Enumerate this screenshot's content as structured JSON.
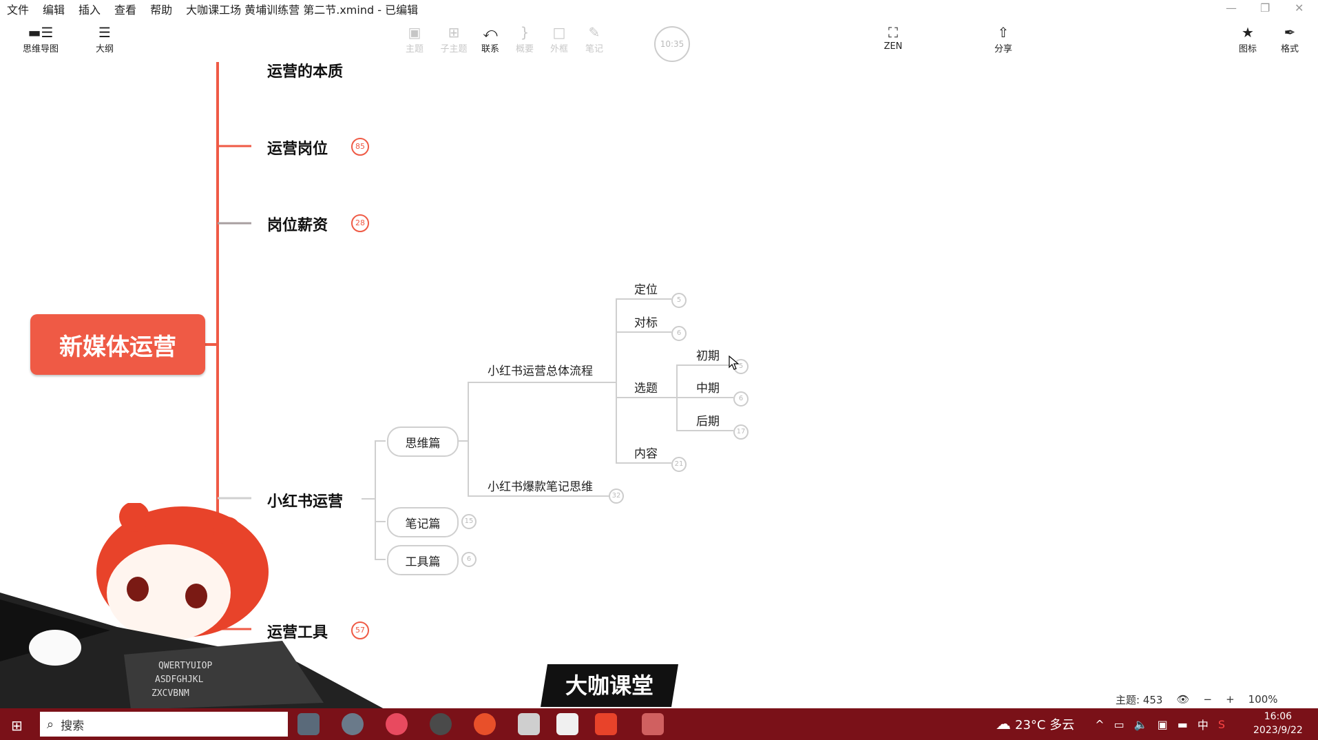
{
  "menu": {
    "items": [
      "文件",
      "编辑",
      "插入",
      "查看",
      "帮助"
    ],
    "title": "大咖课工场 黄埔训练营 第二节.xmind - 已编辑"
  },
  "toolbar": {
    "left": [
      {
        "label": "思维导图",
        "icon": "mindmap-icon"
      },
      {
        "label": "大纲",
        "icon": "outline-icon"
      }
    ],
    "center": [
      {
        "label": "主题",
        "icon": "topic-icon"
      },
      {
        "label": "子主题",
        "icon": "subtopic-icon"
      },
      {
        "label": "联系",
        "icon": "relationship-icon"
      },
      {
        "label": "概要",
        "icon": "summary-icon"
      },
      {
        "label": "外框",
        "icon": "boundary-icon"
      },
      {
        "label": "笔记",
        "icon": "note-icon"
      }
    ],
    "timer": "10:35",
    "zen": "ZEN",
    "share": "分享",
    "icons_label": "图标",
    "format_label": "格式"
  },
  "mindmap": {
    "root": "新媒体运营",
    "main_topics": [
      {
        "label": "运营的本质"
      },
      {
        "label": "运营岗位",
        "count": "85"
      },
      {
        "label": "岗位薪资",
        "count": "28"
      },
      {
        "label": "小红书运营"
      },
      {
        "label": "运营工具",
        "count": "57"
      }
    ],
    "branches": [
      {
        "label": "思维篇"
      },
      {
        "label": "笔记篇",
        "count": "15"
      },
      {
        "label": "工具篇",
        "count": "6"
      }
    ],
    "level3": [
      {
        "label": "小红书运营总体流程"
      },
      {
        "label": "小红书爆款笔记思维",
        "count": "32"
      }
    ],
    "level4": [
      {
        "label": "定位",
        "count": "5"
      },
      {
        "label": "对标",
        "count": "6"
      },
      {
        "label": "选题"
      },
      {
        "label": "内容",
        "count": "21"
      }
    ],
    "level5": [
      {
        "label": "初期",
        "count": "5"
      },
      {
        "label": "中期",
        "count": "6"
      },
      {
        "label": "后期",
        "count": "17"
      }
    ]
  },
  "statusbar": {
    "topics": "主题: 453",
    "zoom": "100%"
  },
  "taskbar": {
    "search_placeholder": "搜索",
    "weather": "23°C 多云",
    "ime": "中",
    "time": "16:06",
    "date": "2023/9/22"
  },
  "watermark": {
    "logo_text": "大咖课堂"
  },
  "colors": {
    "accent": "#ef5a45",
    "taskbar": "#7a1118",
    "connector_grey": "#cfcfcf"
  }
}
